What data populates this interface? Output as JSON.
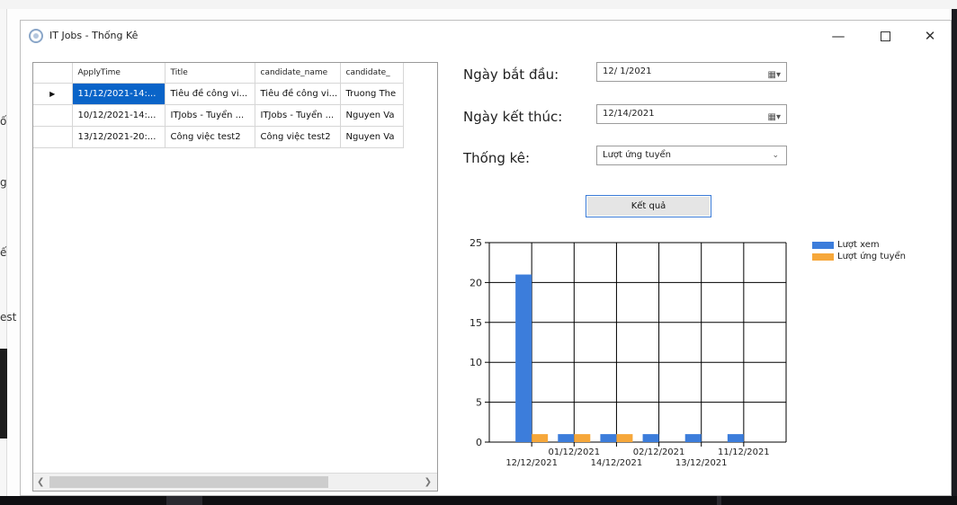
{
  "window": {
    "title": "IT Jobs - Thống Kê"
  },
  "background_fragments": [
    "ố",
    "g",
    "ế",
    "est"
  ],
  "grid": {
    "columns": [
      "ApplyTime",
      "Title",
      "candidate_name",
      "candidate_"
    ],
    "rows": [
      [
        "11/12/2021-14:...",
        "Tiêu đề công vi...",
        "Tiêu đề công vi...",
        "Truong The"
      ],
      [
        "10/12/2021-14:...",
        "ITJobs - Tuyển ...",
        "ITJobs - Tuyển ...",
        "Nguyen Va"
      ],
      [
        "13/12/2021-20:...",
        "Công việc test2",
        "Công việc test2",
        "Nguyen Va"
      ]
    ]
  },
  "form": {
    "start_label": "Ngày bắt đầu:",
    "start_value": "12/ 1/2021",
    "end_label": "Ngày kết thúc:",
    "end_value": "12/14/2021",
    "stat_label": "Thống kê:",
    "stat_value": "Lượt ứng tuyển",
    "result_button": "Kết quả"
  },
  "colors": {
    "accent": "#0a64c8",
    "series_views": "#3c7ddb",
    "series_applies": "#f6a73a"
  },
  "chart_data": {
    "type": "bar",
    "categories": [
      "12/12/2021",
      "01/12/2021",
      "14/12/2021",
      "02/12/2021",
      "13/12/2021",
      "11/12/2021"
    ],
    "series": [
      {
        "name": "Lượt xem",
        "values": [
          21,
          1,
          1,
          1,
          1,
          1
        ]
      },
      {
        "name": "Lượt ứng tuyển",
        "values": [
          1,
          1,
          1,
          0,
          0,
          0
        ]
      }
    ],
    "ylim": [
      0,
      25
    ],
    "yticks": [
      0,
      5,
      10,
      15,
      20,
      25
    ],
    "grid": true,
    "legend": "top-right"
  }
}
